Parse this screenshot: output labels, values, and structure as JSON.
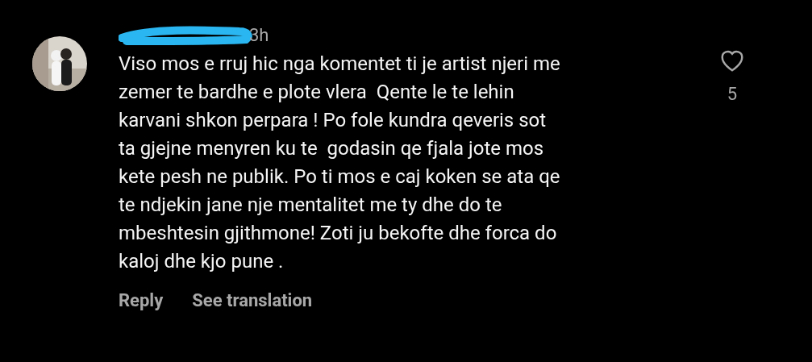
{
  "comment": {
    "time": "3h",
    "text": "Viso mos e rruj hic nga komentet ti je artist njeri me\nzemer te bardhe e plote vlera  Qente le te lehin\nkarvani shkon perpara ! Po fole kundra qeveris sot\nta gjejne menyren ku te  godasin qe fjala jote mos\nkete pesh ne publik. Po ti mos e caj koken se ata qe\nte ndjekin jane nje mentalitet me ty dhe do te\nmbeshtesin gjithmone! Zoti ju bekofte dhe forca do\nkaloj dhe kjo pune .",
    "likes": "5",
    "actions": [
      "Reply",
      "See translation"
    ]
  }
}
